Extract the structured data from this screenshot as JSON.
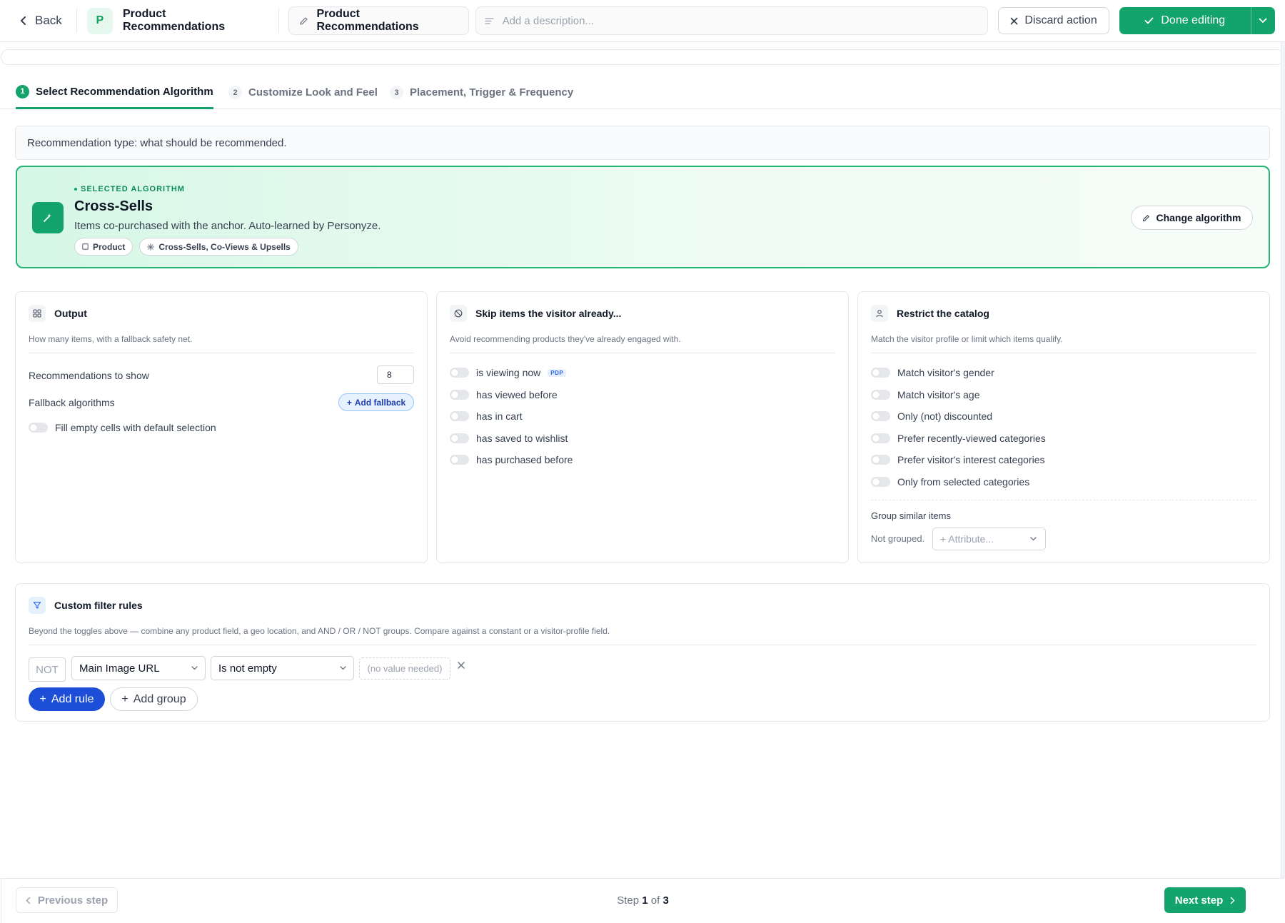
{
  "header": {
    "back_label": "Back",
    "app_badge": "P",
    "app_name": "Product Recommendations",
    "name_value": "Product Recommendations",
    "description_placeholder": "Add a description...",
    "discard_label": "Discard action",
    "done_label": "Done editing"
  },
  "steps": [
    {
      "num": "1",
      "label": "Select Recommendation Algorithm",
      "active": true
    },
    {
      "num": "2",
      "label": "Customize Look and Feel",
      "active": false
    },
    {
      "num": "3",
      "label": "Placement, Trigger & Frequency",
      "active": false
    }
  ],
  "recommendation_type_text": "Recommendation type: what should be recommended.",
  "algorithm": {
    "selected_label": "SELECTED ALGORITHM",
    "name": "Cross-Sells",
    "description": "Items co-purchased with the anchor. Auto-learned by Personyze.",
    "chip_product": "Product",
    "chip_family": "Cross-Sells, Co-Views & Upsells",
    "change_label": "Change algorithm"
  },
  "output_card": {
    "title": "Output",
    "subtitle": "How many items, with a fallback safety net.",
    "recs_label": "Recommendations to show",
    "recs_value": "8",
    "fallback_label": "Fallback algorithms",
    "add_fallback_label": "Add fallback",
    "fill_empty_label": "Fill empty cells with default selection"
  },
  "skip_card": {
    "title": "Skip items the visitor already...",
    "subtitle": "Avoid recommending products they've already engaged with.",
    "items": [
      "is viewing now",
      "has viewed before",
      "has in cart",
      "has saved to wishlist",
      "has purchased before"
    ],
    "pdp_badge": "PDP"
  },
  "restrict_card": {
    "title": "Restrict the catalog",
    "subtitle": "Match the visitor profile or limit which items qualify.",
    "items": [
      "Match visitor's gender",
      "Match visitor's age",
      "Only (not) discounted",
      "Prefer recently-viewed categories",
      "Prefer visitor's interest categories",
      "Only from selected categories"
    ],
    "group_label": "Group similar items",
    "not_grouped": "Not grouped.",
    "attribute_placeholder": "+ Attribute..."
  },
  "filters": {
    "title": "Custom filter rules",
    "subtitle": "Beyond the toggles above — combine any product field, a geo location, and AND / OR / NOT groups. Compare against a constant or a visitor-profile field.",
    "not_label": "NOT",
    "field_value": "Main Image URL",
    "operator_value": "Is not empty",
    "value_placeholder": "(no value needed)",
    "add_rule_label": "Add rule",
    "add_group_label": "Add group"
  },
  "footer": {
    "prev_label": "Previous step",
    "step_prefix": "Step",
    "step_current": "1",
    "step_of": "of",
    "step_total": "3",
    "next_label": "Next step"
  },
  "colors": {
    "accent_green": "#12a46b",
    "primary_blue": "#1d4ed8"
  }
}
